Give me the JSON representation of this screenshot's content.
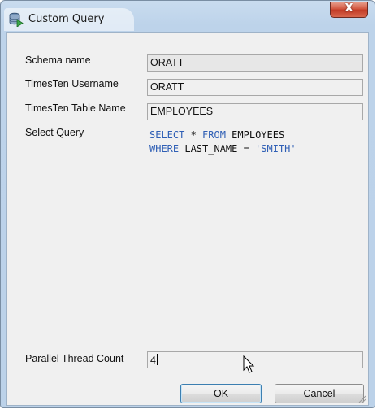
{
  "window": {
    "title": "Custom Query",
    "close_icon_label": "X"
  },
  "form": {
    "schema_name": {
      "label": "Schema name",
      "value": "ORATT"
    },
    "timesten_username": {
      "label": "TimesTen Username",
      "value": "ORATT"
    },
    "timesten_table_name": {
      "label": "TimesTen Table Name",
      "value": "EMPLOYEES"
    },
    "select_query": {
      "label": "Select Query",
      "line1": {
        "kw1": "SELECT",
        "mid": " * ",
        "kw2": "FROM",
        "rest": " EMPLOYEES"
      },
      "line2": {
        "kw": "WHERE",
        "mid": " LAST_NAME = ",
        "str": "'SMITH'"
      }
    },
    "parallel_thread_count": {
      "label": "Parallel Thread Count",
      "value": "4"
    }
  },
  "buttons": {
    "ok_label": "OK",
    "cancel_label": "Cancel"
  },
  "icons": {
    "app": "database-icon",
    "close": "close-icon",
    "cursor": "mouse-pointer-icon",
    "resize": "resize-grip-icon"
  },
  "colors": {
    "title_bar": "#bcd2e9",
    "close_button": "#c94a34",
    "client_background": "#f0f0f0",
    "sql_keyword": "#2f5fb5",
    "ok_button_focus": "#3c7fb1"
  }
}
